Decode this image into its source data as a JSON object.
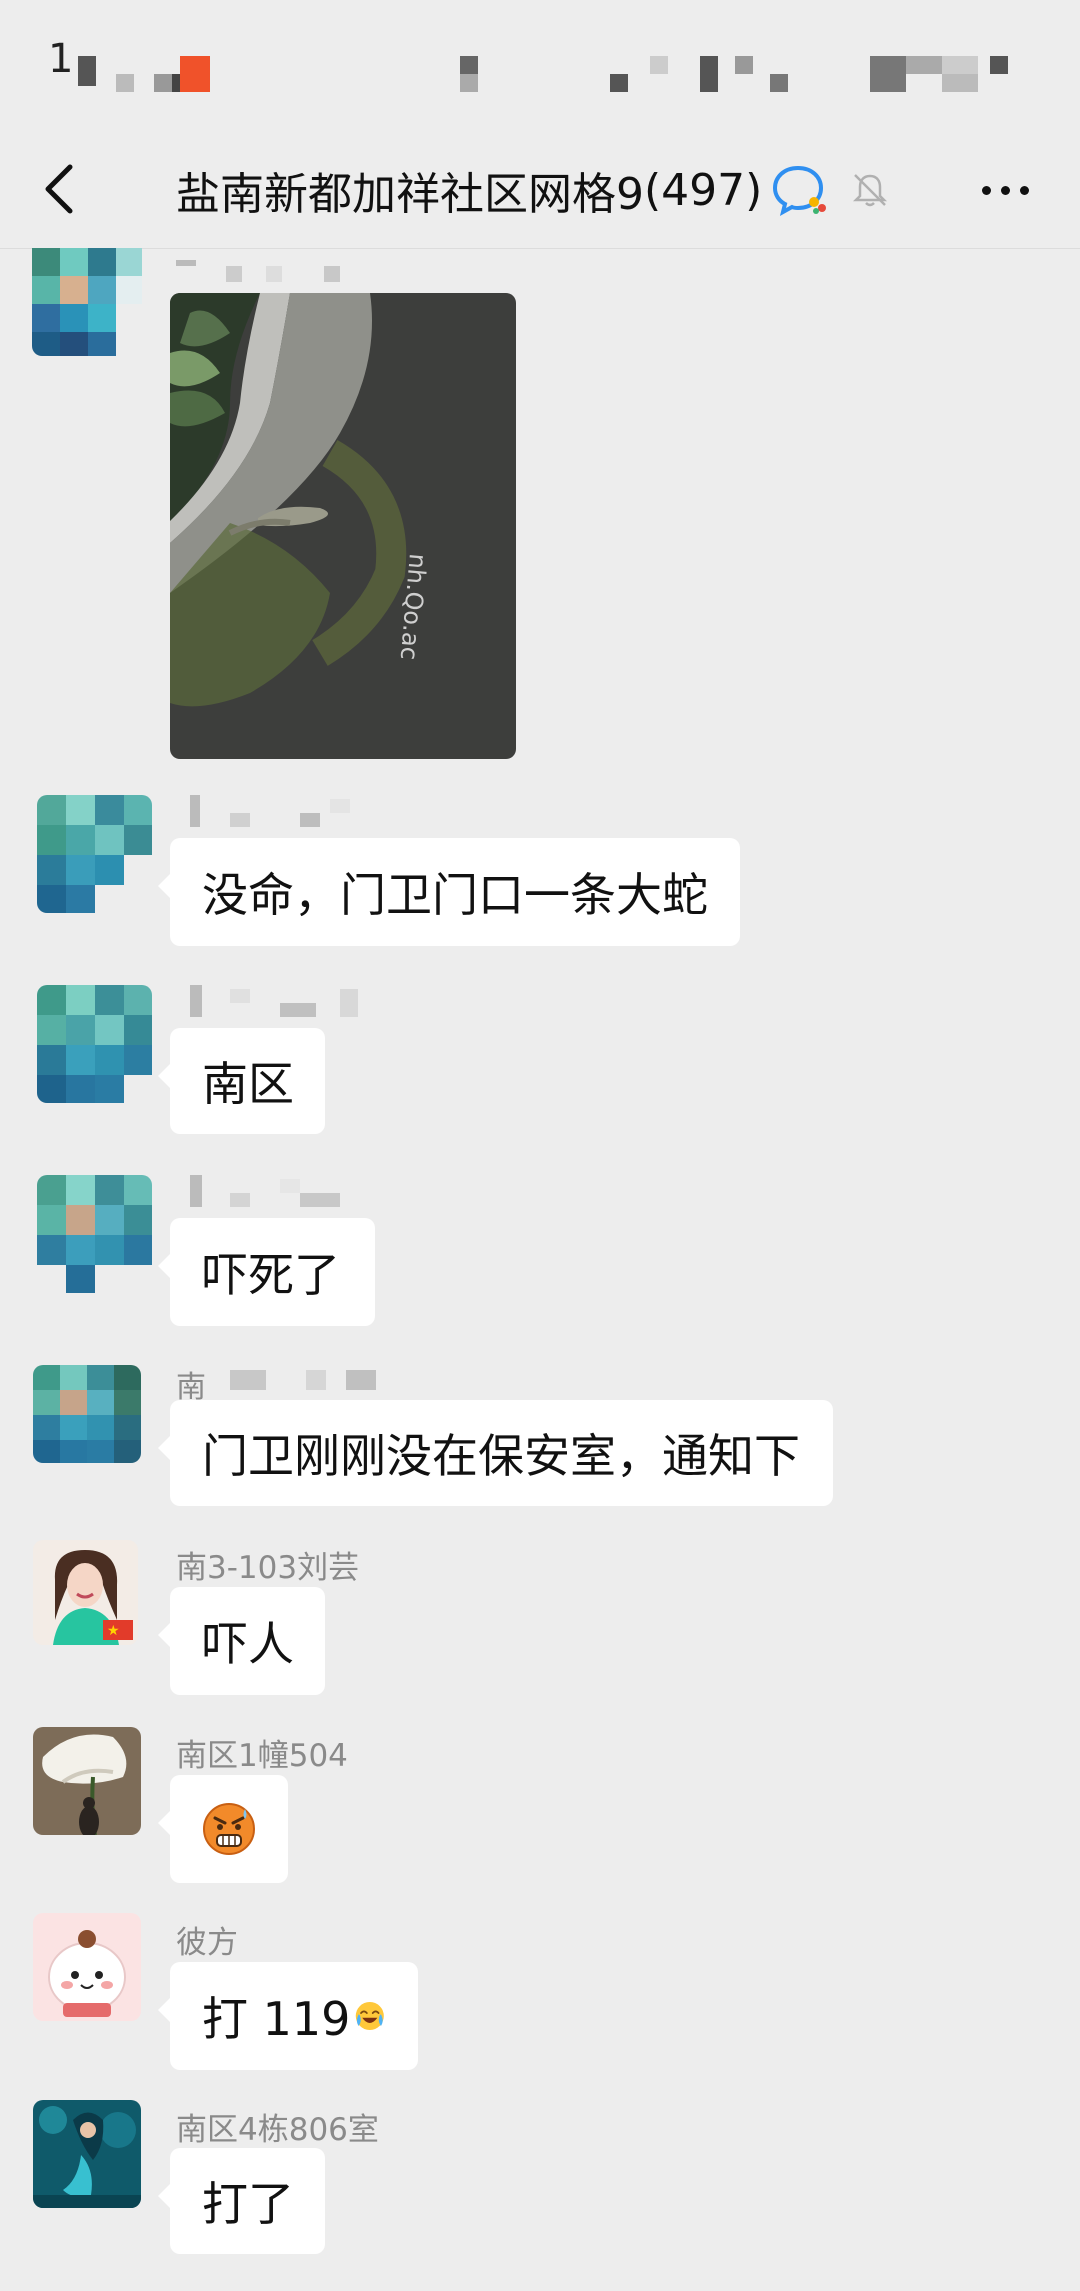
{
  "status_bar": {
    "time": "1"
  },
  "header": {
    "title": "盐南新都加祥社区网格9",
    "member_count": "(497)",
    "icons": {
      "back": "chevron-left-icon",
      "wecom": "wecom-chat-icon",
      "mute": "bell-muted-icon",
      "more": "more-dots-icon"
    }
  },
  "messages": [
    {
      "sender": "",
      "type": "image",
      "image_desc_icon": "photo"
    },
    {
      "sender": "",
      "text": "没命，门卫门口一条大蛇"
    },
    {
      "sender": "",
      "text": "南区"
    },
    {
      "sender": "",
      "text": "吓死了"
    },
    {
      "sender": "南",
      "text": "门卫刚刚没在保安室，通知下"
    },
    {
      "sender": "南3-103刘芸",
      "text": "吓人"
    },
    {
      "sender": "南区1幢504",
      "text": "",
      "emoji": "scared-face-emoji"
    },
    {
      "sender": "彼方",
      "text": "打 119",
      "emoji": "crying-laughing-emoji"
    },
    {
      "sender": "南区4栋806室",
      "text": "打了"
    }
  ],
  "colors": {
    "background": "#ededed",
    "bubble": "#ffffff",
    "sender_text": "#8a8a8a",
    "wecom_blue": "#2f8ff0"
  }
}
